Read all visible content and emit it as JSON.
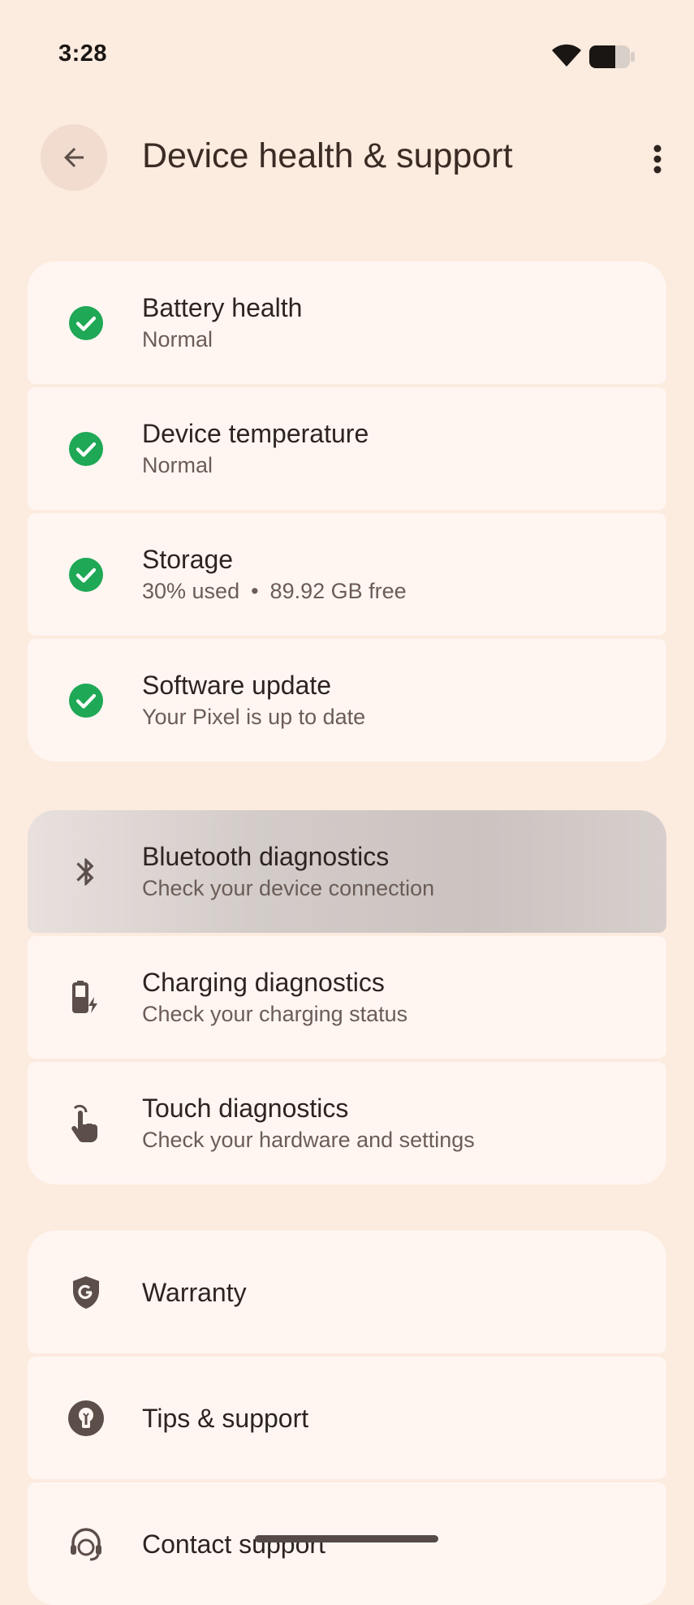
{
  "status_bar": {
    "time": "3:28",
    "wifi_icon": "wifi-icon",
    "battery_icon": "battery-icon"
  },
  "app_bar": {
    "title": "Device health & support",
    "back_icon": "arrow-back-icon",
    "more_icon": "more-vertical-icon"
  },
  "health_checks": [
    {
      "title": "Battery health",
      "subtitle": "Normal",
      "icon": "check-circle-icon"
    },
    {
      "title": "Device temperature",
      "subtitle": "Normal",
      "icon": "check-circle-icon"
    },
    {
      "title": "Storage",
      "subtitle_used": "30% used",
      "subtitle_sep": "•",
      "subtitle_free": "89.92 GB free",
      "icon": "check-circle-icon"
    },
    {
      "title": "Software update",
      "subtitle": "Your Pixel is up to date",
      "icon": "check-circle-icon"
    }
  ],
  "diagnostics": [
    {
      "title": "Bluetooth diagnostics",
      "subtitle": "Check your device connection",
      "icon": "bluetooth-icon"
    },
    {
      "title": "Charging diagnostics",
      "subtitle": "Check your charging status",
      "icon": "battery-charging-icon"
    },
    {
      "title": "Touch diagnostics",
      "subtitle": "Check your hardware and settings",
      "icon": "touch-hand-icon"
    }
  ],
  "support": [
    {
      "title": "Warranty",
      "icon": "google-shield-icon"
    },
    {
      "title": "Tips & support",
      "icon": "lightbulb-icon"
    },
    {
      "title": "Contact support",
      "icon": "headset-agent-icon"
    }
  ],
  "colors": {
    "background": "#fcebdf",
    "card": "#fff6f2",
    "check_green": "#1fa855",
    "icon_brown": "#5c4e48"
  }
}
